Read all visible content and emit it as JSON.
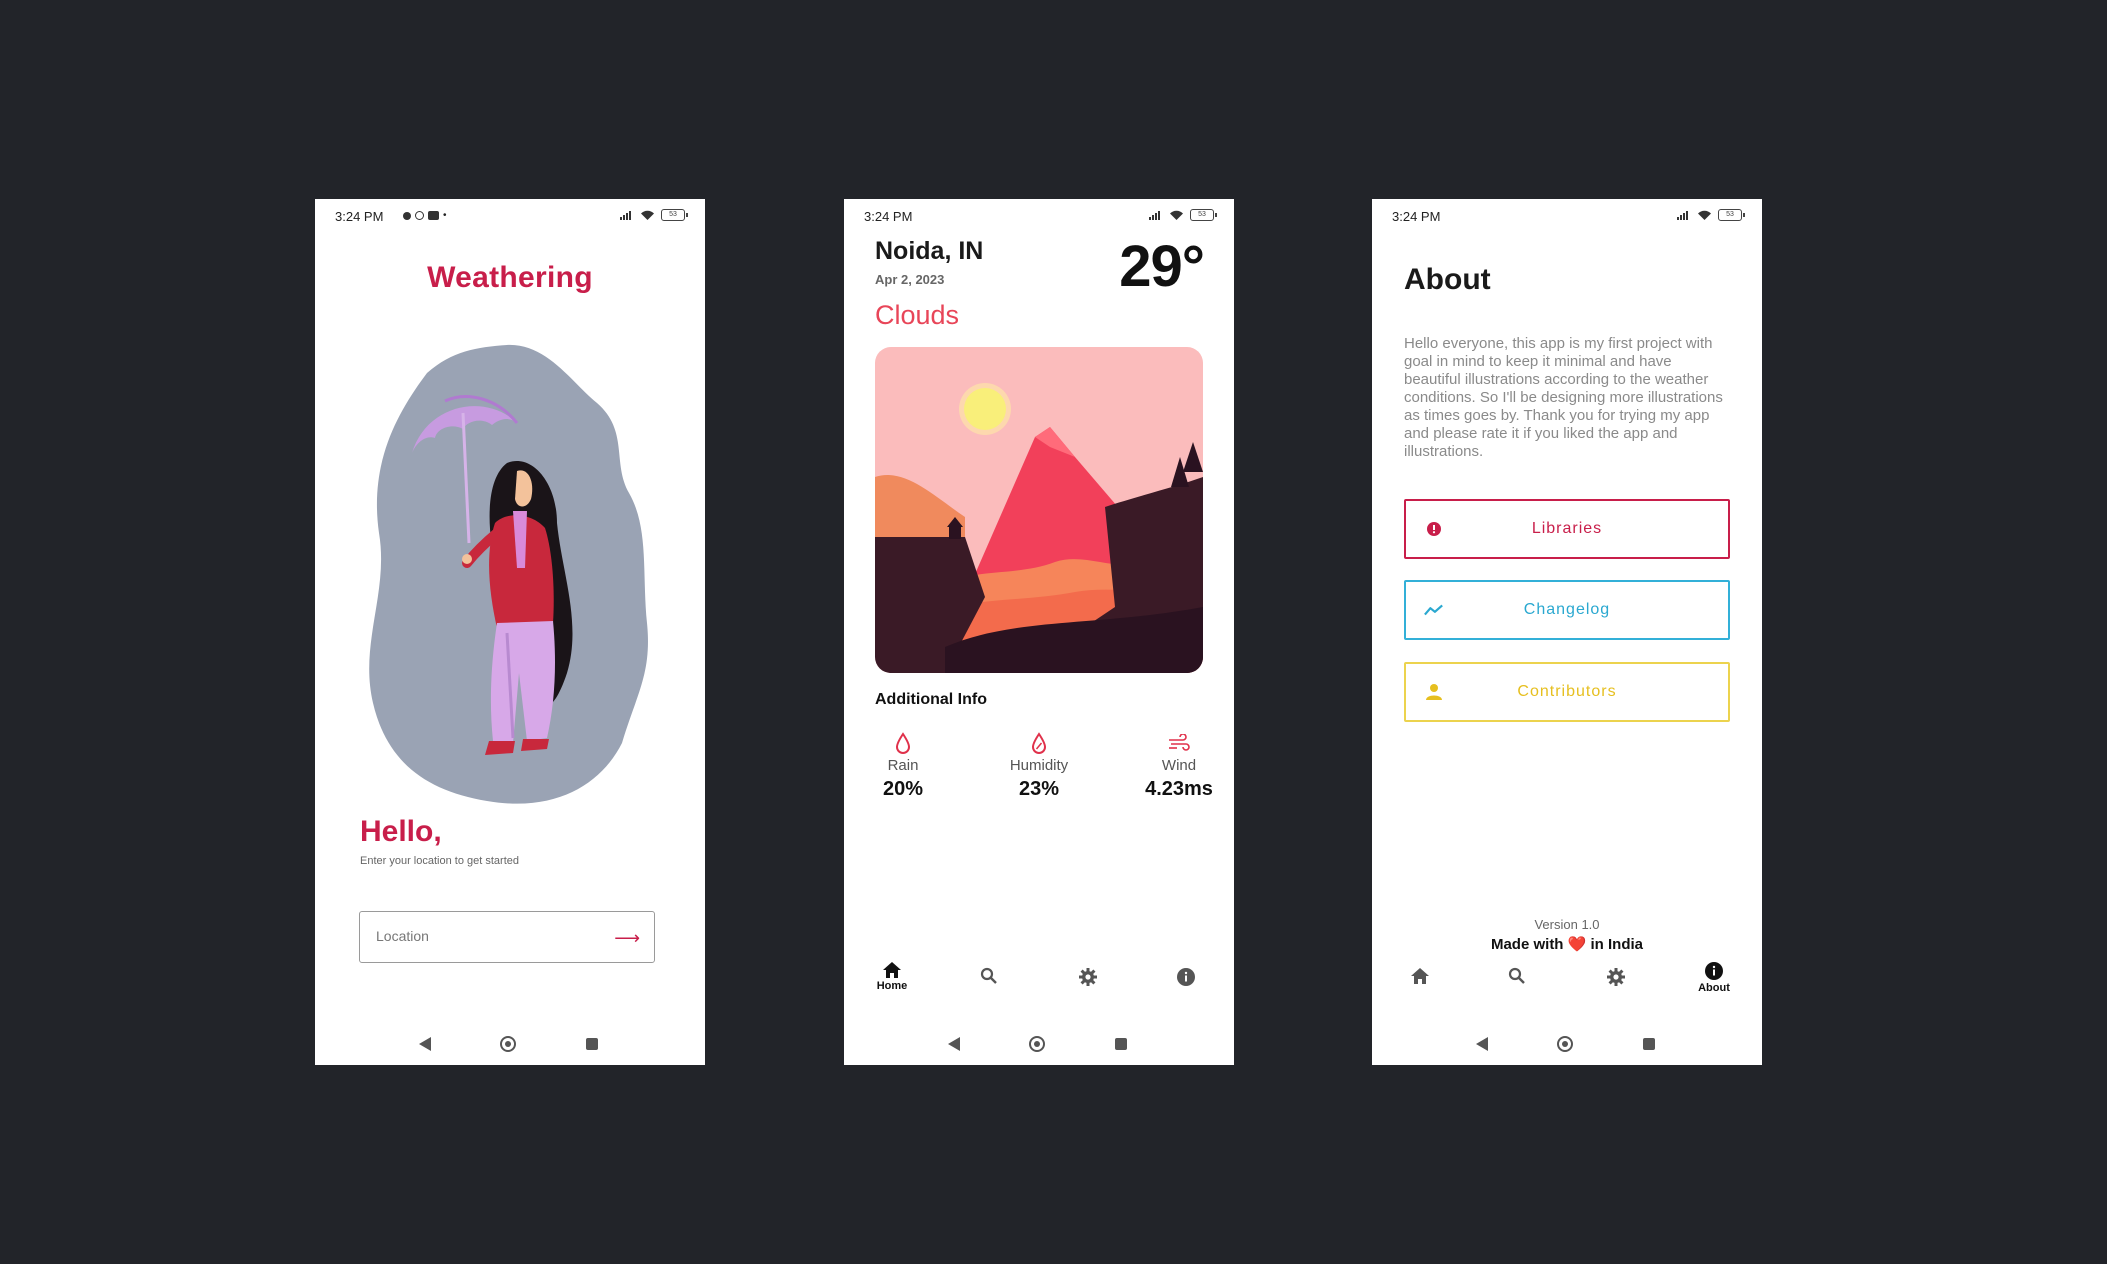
{
  "status_bar": {
    "time": "3:24 PM",
    "battery": "53"
  },
  "welcome": {
    "app_title": "Weathering",
    "hello": "Hello,",
    "subtitle": "Enter your location to get started",
    "location_placeholder": "Location",
    "location_value": ""
  },
  "home": {
    "city": "Noida, IN",
    "date": "Apr 2, 2023",
    "temperature": "29°",
    "condition": "Clouds",
    "additional_info_title": "Additional Info",
    "stats": {
      "rain": {
        "label": "Rain",
        "value": "20%"
      },
      "humidity": {
        "label": "Humidity",
        "value": "23%"
      },
      "wind": {
        "label": "Wind",
        "value": "4.23ms"
      }
    }
  },
  "about": {
    "title": "About",
    "description": "Hello everyone, this app is my first project with goal in mind to keep it minimal and have beautiful illustrations according to the weather conditions. So I'll be designing more illustrations as times goes by. Thank you for trying my app and please rate it if you liked the app and illustrations.",
    "buttons": {
      "libraries": "Libraries",
      "changelog": "Changelog",
      "contributors": "Contributors"
    },
    "version": "Version 1.0",
    "made_with_prefix": "Made with",
    "made_with_heart": "❤️",
    "made_with_suffix": "in India"
  },
  "bottom_nav": {
    "home_label": "Home",
    "about_label": "About",
    "items": [
      "home-icon",
      "search-icon",
      "gear-icon",
      "info-icon"
    ]
  },
  "colors": {
    "background": "#222429",
    "brand": "#c81e4a",
    "condition": "#e84558",
    "changelog": "#33b0d8",
    "contributors": "#ecd34e"
  }
}
